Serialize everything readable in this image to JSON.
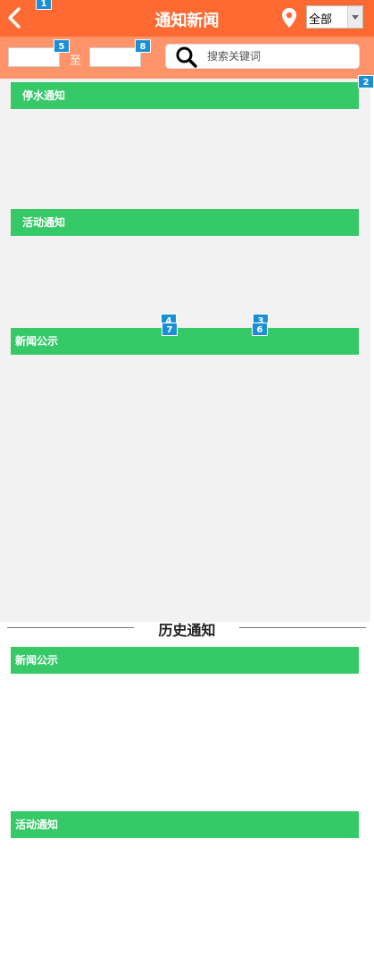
{
  "header": {
    "title": "通知新闻",
    "region_select": "全部"
  },
  "filter": {
    "to_label": "至",
    "search_placeholder": "搜索关键词"
  },
  "sections": [
    {
      "label": "停水通知"
    },
    {
      "label": "活动通知"
    },
    {
      "label": "新闻公示"
    }
  ],
  "history": {
    "title": "历史通知",
    "sections": [
      {
        "label": "新闻公示"
      },
      {
        "label": "活动通知"
      }
    ]
  },
  "badges": [
    "1",
    "2",
    "3",
    "4",
    "5",
    "6",
    "7",
    "8"
  ],
  "colors": {
    "header": "#ff6a33",
    "filter": "#ff946b",
    "section_bar": "#35c968",
    "badge": "#1a8fd6"
  }
}
